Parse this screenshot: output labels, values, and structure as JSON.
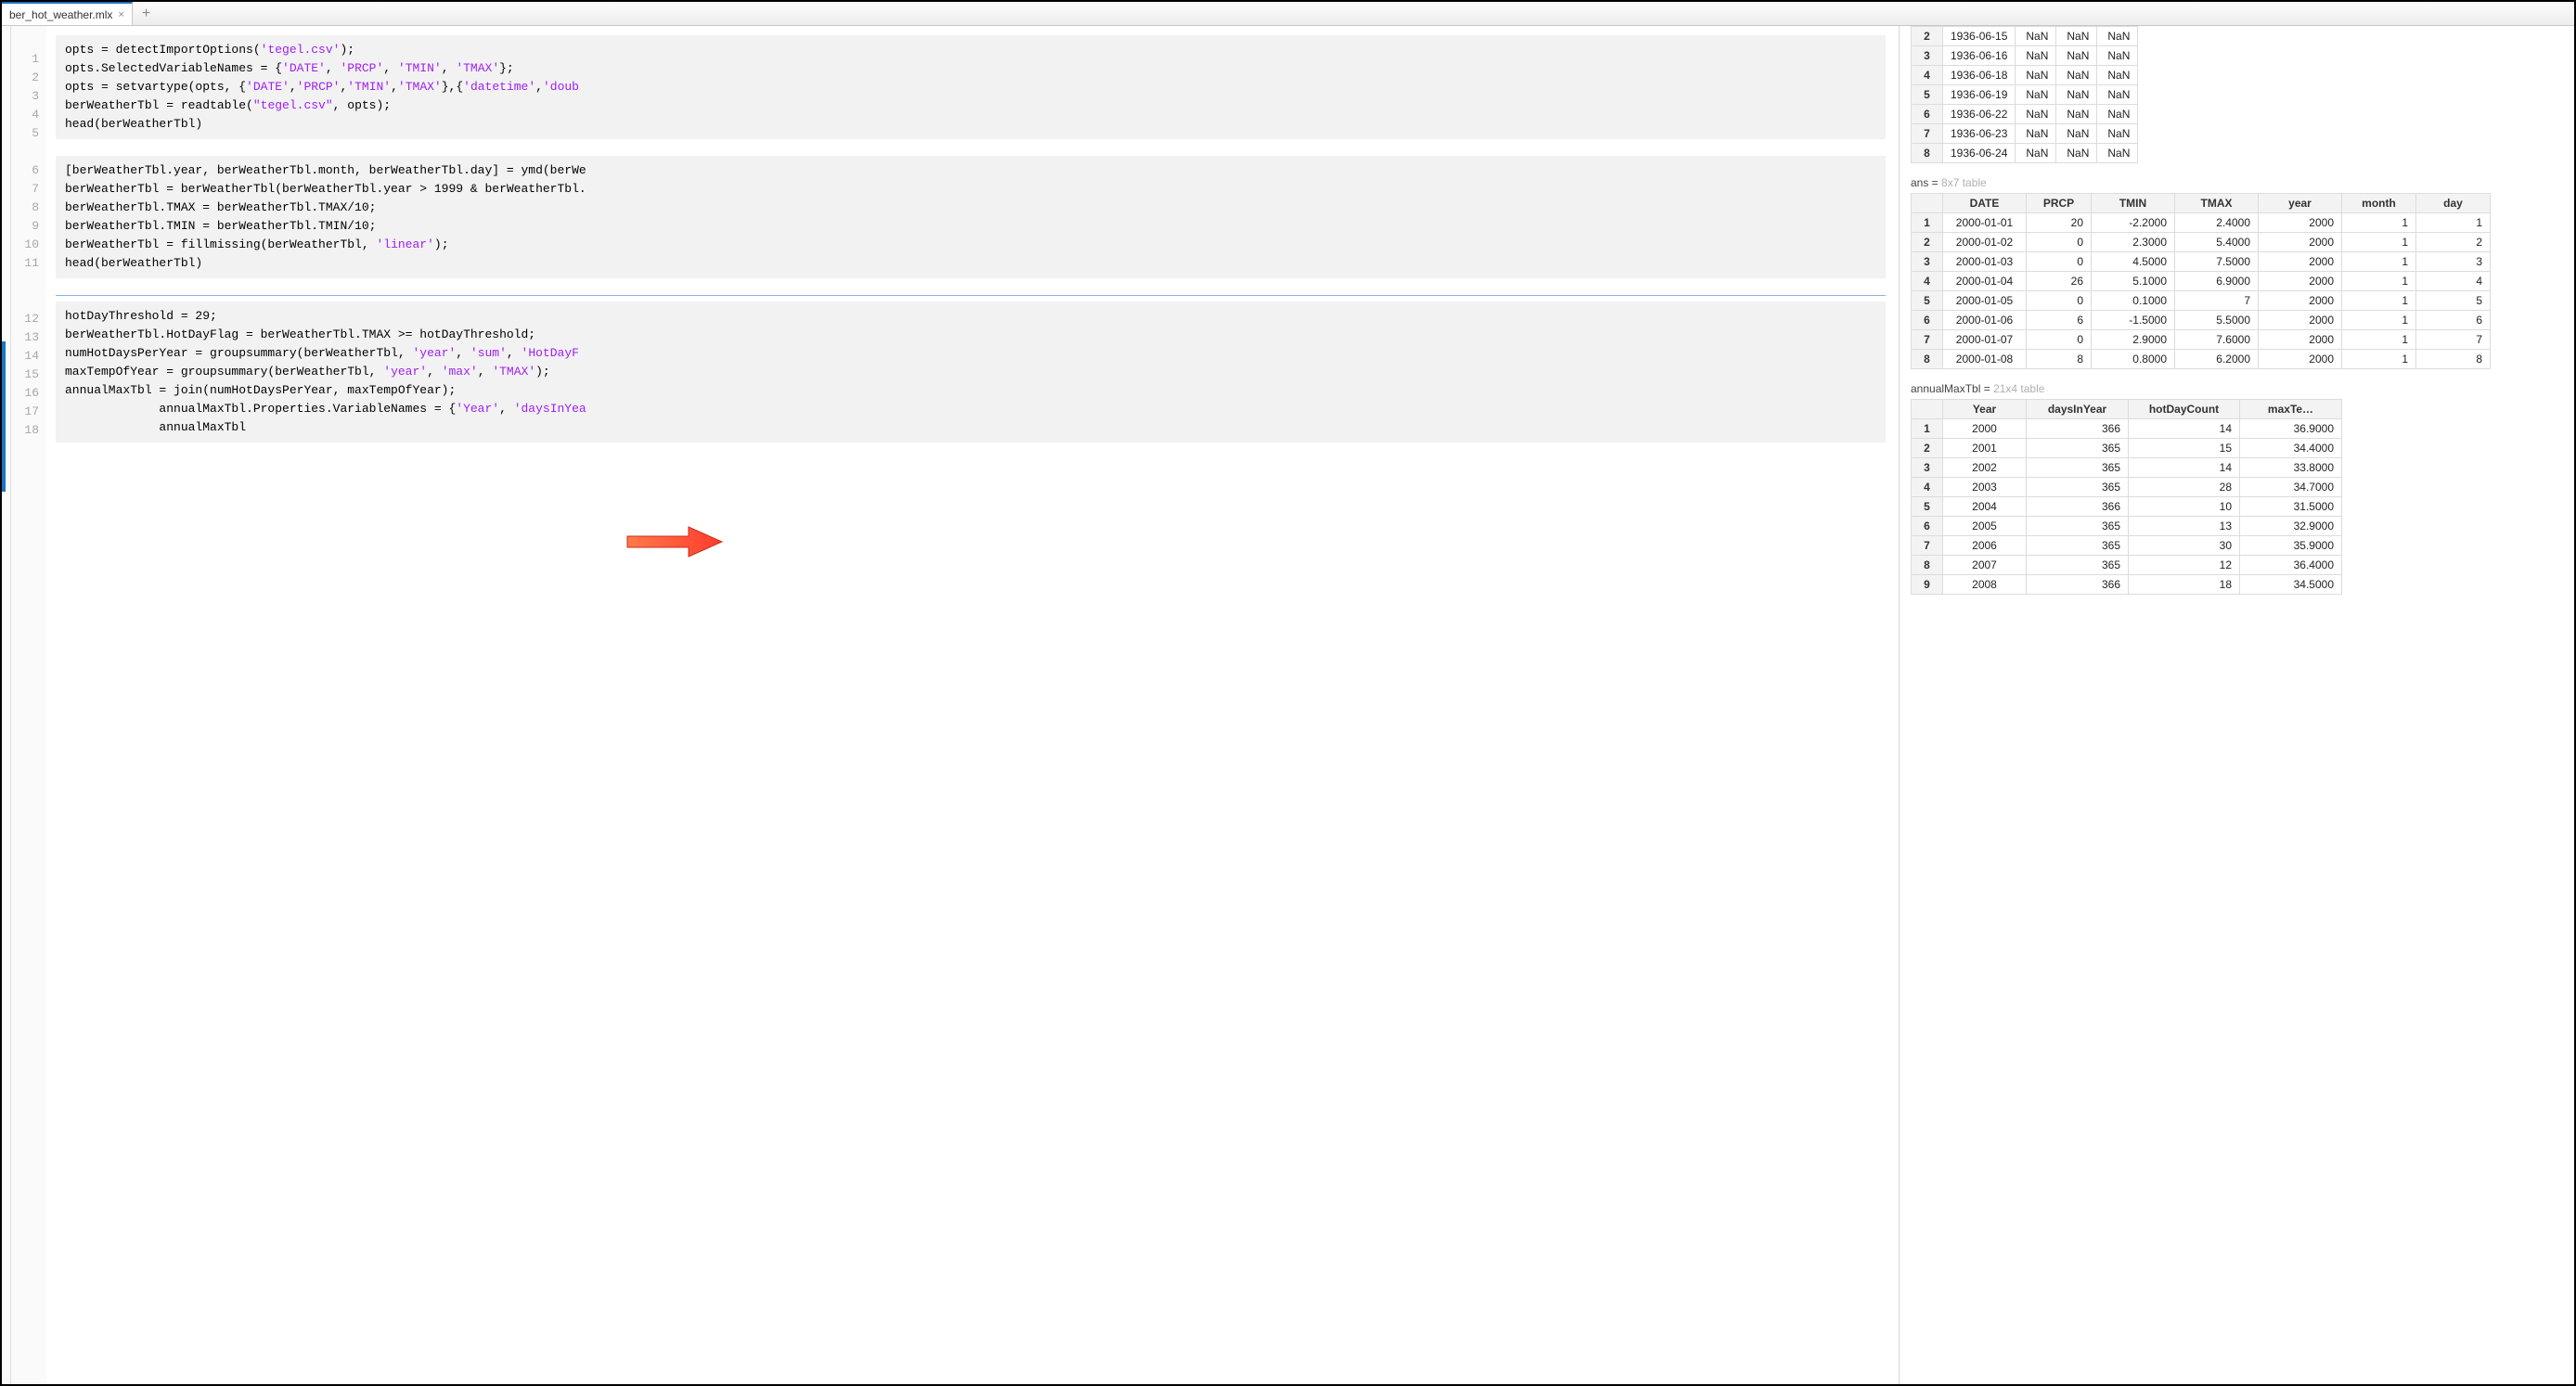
{
  "tab": {
    "filename": "ber_hot_weather.mlx"
  },
  "gutter_lines": [
    1,
    2,
    3,
    4,
    5,
    6,
    7,
    8,
    9,
    10,
    11,
    12,
    13,
    14,
    15,
    16,
    17,
    18
  ],
  "code": {
    "block1": [
      [
        [
          "opts = detectImportOptions(",
          ""
        ],
        [
          "'tegel.csv'",
          "s"
        ],
        [
          ");",
          ""
        ]
      ],
      [
        [
          "opts.SelectedVariableNames = {",
          ""
        ],
        [
          "'DATE'",
          "s"
        ],
        [
          ", ",
          ""
        ],
        [
          "'PRCP'",
          "s"
        ],
        [
          ", ",
          ""
        ],
        [
          "'TMIN'",
          "s"
        ],
        [
          ", ",
          ""
        ],
        [
          "'TMAX'",
          "s"
        ],
        [
          "};",
          ""
        ]
      ],
      [
        [
          "opts = setvartype(opts, {",
          ""
        ],
        [
          "'DATE'",
          "s"
        ],
        [
          ",",
          ""
        ],
        [
          "'PRCP'",
          "s"
        ],
        [
          ",",
          ""
        ],
        [
          "'TMIN'",
          "s"
        ],
        [
          ",",
          ""
        ],
        [
          "'TMAX'",
          "s"
        ],
        [
          "},{",
          ""
        ],
        [
          "'datetime'",
          "s"
        ],
        [
          ",",
          ""
        ],
        [
          "'doub",
          "s"
        ]
      ],
      [
        [
          "berWeatherTbl = readtable(",
          ""
        ],
        [
          "\"tegel.csv\"",
          "s"
        ],
        [
          ", opts);",
          ""
        ]
      ],
      [
        [
          "head(berWeatherTbl)",
          ""
        ]
      ]
    ],
    "block2": [
      [
        [
          "[berWeatherTbl.year, berWeatherTbl.month, berWeatherTbl.day] = ymd(berWe",
          ""
        ]
      ],
      [
        [
          "berWeatherTbl = berWeatherTbl(berWeatherTbl.year > 1999 & berWeatherTbl.",
          ""
        ]
      ],
      [
        [
          "berWeatherTbl.TMAX = berWeatherTbl.TMAX/10;",
          ""
        ]
      ],
      [
        [
          "berWeatherTbl.TMIN = berWeatherTbl.TMIN/10;",
          ""
        ]
      ],
      [
        [
          "berWeatherTbl = fillmissing(berWeatherTbl, ",
          ""
        ],
        [
          "'linear'",
          "s"
        ],
        [
          ");",
          ""
        ]
      ],
      [
        [
          "head(berWeatherTbl)",
          ""
        ]
      ]
    ],
    "block3": [
      [
        [
          "hotDayThreshold = 29;",
          ""
        ]
      ],
      [
        [
          "berWeatherTbl.HotDayFlag = berWeatherTbl.TMAX >= hotDayThreshold;",
          ""
        ]
      ],
      [
        [
          "numHotDaysPerYear = groupsummary(berWeatherTbl, ",
          ""
        ],
        [
          "'year'",
          "s"
        ],
        [
          ", ",
          ""
        ],
        [
          "'sum'",
          "s"
        ],
        [
          ", ",
          ""
        ],
        [
          "'HotDayF",
          "s"
        ]
      ],
      [
        [
          "maxTempOfYear = groupsummary(berWeatherTbl, ",
          ""
        ],
        [
          "'year'",
          "s"
        ],
        [
          ", ",
          ""
        ],
        [
          "'max'",
          "s"
        ],
        [
          ", ",
          ""
        ],
        [
          "'TMAX'",
          "s"
        ],
        [
          ");",
          ""
        ]
      ],
      [
        [
          "annualMaxTbl = join(numHotDaysPerYear, maxTempOfYear);",
          ""
        ]
      ],
      [
        [
          "             annualMaxTbl.Properties.VariableNames = {",
          ""
        ],
        [
          "'Year'",
          "s"
        ],
        [
          ", ",
          ""
        ],
        [
          "'daysInYea",
          "s"
        ]
      ],
      [
        [
          "             annualMaxTbl",
          ""
        ]
      ]
    ]
  },
  "output": {
    "table1": {
      "rows": [
        [
          "2",
          "1936-06-15",
          "NaN",
          "NaN",
          "NaN"
        ],
        [
          "3",
          "1936-06-16",
          "NaN",
          "NaN",
          "NaN"
        ],
        [
          "4",
          "1936-06-18",
          "NaN",
          "NaN",
          "NaN"
        ],
        [
          "5",
          "1936-06-19",
          "NaN",
          "NaN",
          "NaN"
        ],
        [
          "6",
          "1936-06-22",
          "NaN",
          "NaN",
          "NaN"
        ],
        [
          "7",
          "1936-06-23",
          "NaN",
          "NaN",
          "NaN"
        ],
        [
          "8",
          "1936-06-24",
          "NaN",
          "NaN",
          "NaN"
        ]
      ]
    },
    "table2": {
      "label_prefix": "ans = ",
      "label_dim": "8x7 table",
      "headers": [
        "",
        "DATE",
        "PRCP",
        "TMIN",
        "TMAX",
        "year",
        "month",
        "day"
      ],
      "rows": [
        [
          "1",
          "2000-01-01",
          "20",
          "-2.2000",
          "2.4000",
          "2000",
          "1",
          "1"
        ],
        [
          "2",
          "2000-01-02",
          "0",
          "2.3000",
          "5.4000",
          "2000",
          "1",
          "2"
        ],
        [
          "3",
          "2000-01-03",
          "0",
          "4.5000",
          "7.5000",
          "2000",
          "1",
          "3"
        ],
        [
          "4",
          "2000-01-04",
          "26",
          "5.1000",
          "6.9000",
          "2000",
          "1",
          "4"
        ],
        [
          "5",
          "2000-01-05",
          "0",
          "0.1000",
          "7",
          "2000",
          "1",
          "5"
        ],
        [
          "6",
          "2000-01-06",
          "6",
          "-1.5000",
          "5.5000",
          "2000",
          "1",
          "6"
        ],
        [
          "7",
          "2000-01-07",
          "0",
          "2.9000",
          "7.6000",
          "2000",
          "1",
          "7"
        ],
        [
          "8",
          "2000-01-08",
          "8",
          "0.8000",
          "6.2000",
          "2000",
          "1",
          "8"
        ]
      ]
    },
    "table3": {
      "label_prefix": "annualMaxTbl = ",
      "label_dim": "21x4 table",
      "headers": [
        "",
        "Year",
        "daysInYear",
        "hotDayCount",
        "maxTe…"
      ],
      "rows": [
        [
          "1",
          "2000",
          "366",
          "14",
          "36.9000"
        ],
        [
          "2",
          "2001",
          "365",
          "15",
          "34.4000"
        ],
        [
          "3",
          "2002",
          "365",
          "14",
          "33.8000"
        ],
        [
          "4",
          "2003",
          "365",
          "28",
          "34.7000"
        ],
        [
          "5",
          "2004",
          "366",
          "10",
          "31.5000"
        ],
        [
          "6",
          "2005",
          "365",
          "13",
          "32.9000"
        ],
        [
          "7",
          "2006",
          "365",
          "30",
          "35.9000"
        ],
        [
          "8",
          "2007",
          "365",
          "12",
          "36.4000"
        ],
        [
          "9",
          "2008",
          "366",
          "18",
          "34.5000"
        ]
      ]
    }
  }
}
